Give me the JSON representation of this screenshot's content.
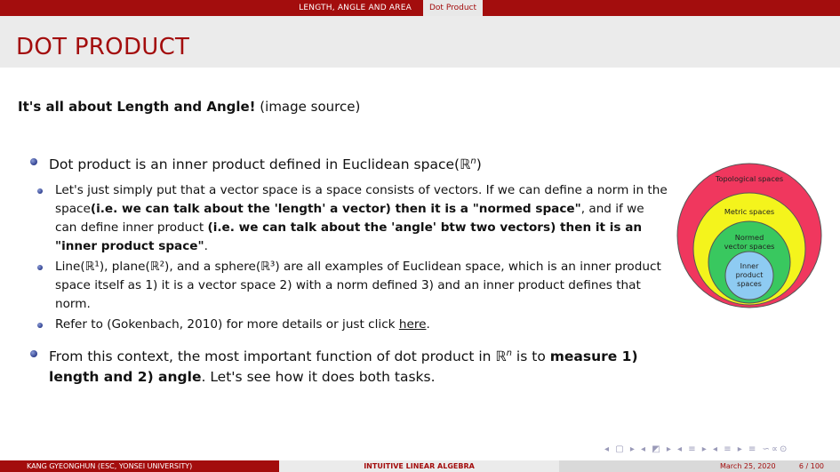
{
  "header": {
    "section": "LENGTH, ANGLE AND AREA",
    "subsection": "Dot Product"
  },
  "slide": {
    "title": "DOT PRODUCT",
    "lead_bold": "It's all about Length and Angle!",
    "lead_normal": " (image source)",
    "bullets": [
      {
        "text": "Dot product is an inner product defined in Euclidean space(ℝ",
        "sup": "n",
        "text_after": ")"
      }
    ],
    "sub1_part1": "Let's just simply put that a vector space is a space consists of vectors. If we can define a norm in the space",
    "sub1_bold1": "(i.e. we can talk about the 'length' a vector) then it is a \"normed space\"",
    "sub1_part2": ", and if we can define inner product ",
    "sub1_bold2": "(i.e. we can talk about the 'angle' btw two vectors) then it is an \"inner product space\"",
    "sub1_end": ".",
    "sub2": "Line(ℝ¹), plane(ℝ²), and a sphere(ℝ³) are all examples of Euclidean space, which is an inner product space itself as 1) it is a vector space 2) with a norm defined 3) and an inner product defines that norm.",
    "sub3_text": "Refer to (Gokenbach, 2010) for more details or just click ",
    "sub3_link": "here",
    "sub3_end": ".",
    "bullet2_part1": "From this context, the most important function of dot product in ℝ",
    "bullet2_sup": "n",
    "bullet2_part2": " is to ",
    "bullet2_bold": "measure 1) length and 2) angle",
    "bullet2_part3": ". Let's see how it does both tasks."
  },
  "diagram": {
    "outer_label": "Topological spaces",
    "metric_label": "Metric spaces",
    "normed_label_1": "Normed",
    "normed_label_2": "vector spaces",
    "inner_label_1": "Inner",
    "inner_label_2": "product",
    "inner_label_3": "spaces",
    "colors": {
      "topological": "#f0375e",
      "metric": "#f4f41c",
      "normed": "#39c85f",
      "inner": "#8ecbf2"
    }
  },
  "nav": "◂ ▢ ▸ ◂ ◩ ▸ ◂ ≡ ▸ ◂ ≡ ▸  ≡  ∽∝⊙",
  "footer": {
    "author": "KANG GYEONGHUN  (ESC, YONSEI UNIVERSITY)",
    "course": "INTUITIVE LINEAR ALGEBRA",
    "date": "March 25, 2020",
    "page": "6 / 100"
  }
}
